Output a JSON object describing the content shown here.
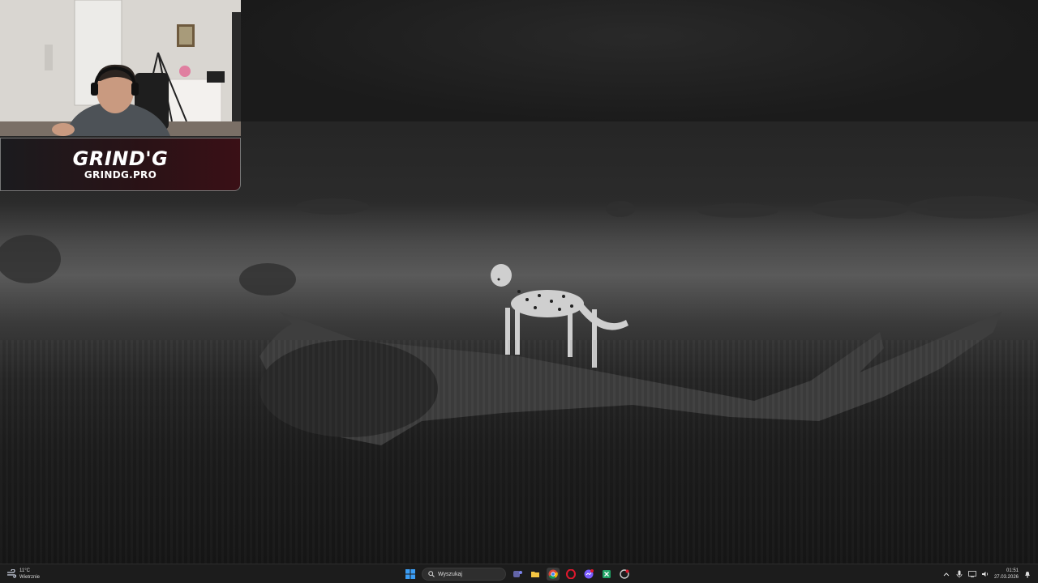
{
  "overlay": {
    "logo_text": "GRIND'G",
    "logo_url": "GRINDG.PRO"
  },
  "taskbar": {
    "weather": {
      "temperature": "11°C",
      "condition": "Wietrznie",
      "icon": "weather-wind-icon"
    },
    "search": {
      "placeholder": "Wyszukaj",
      "icon": "search-icon"
    },
    "apps": [
      {
        "name": "start-button",
        "icon": "windows-logo-icon"
      },
      {
        "name": "teams",
        "icon": "teams-icon"
      },
      {
        "name": "file-explorer",
        "icon": "folder-icon"
      },
      {
        "name": "chrome",
        "icon": "chrome-icon"
      },
      {
        "name": "opera",
        "icon": "opera-icon"
      },
      {
        "name": "messenger",
        "icon": "messenger-icon"
      },
      {
        "name": "excel",
        "icon": "excel-icon"
      },
      {
        "name": "app-red",
        "icon": "app-icon"
      }
    ],
    "clock": {
      "time": "01:51",
      "date": "27.03.2026"
    },
    "colors": {
      "accent": "#0078d4",
      "taskbar_bg": "#1c1c1c",
      "opera_red": "#e0182d",
      "explorer_yellow": "#f5c542",
      "excel_green": "#21a366"
    }
  }
}
